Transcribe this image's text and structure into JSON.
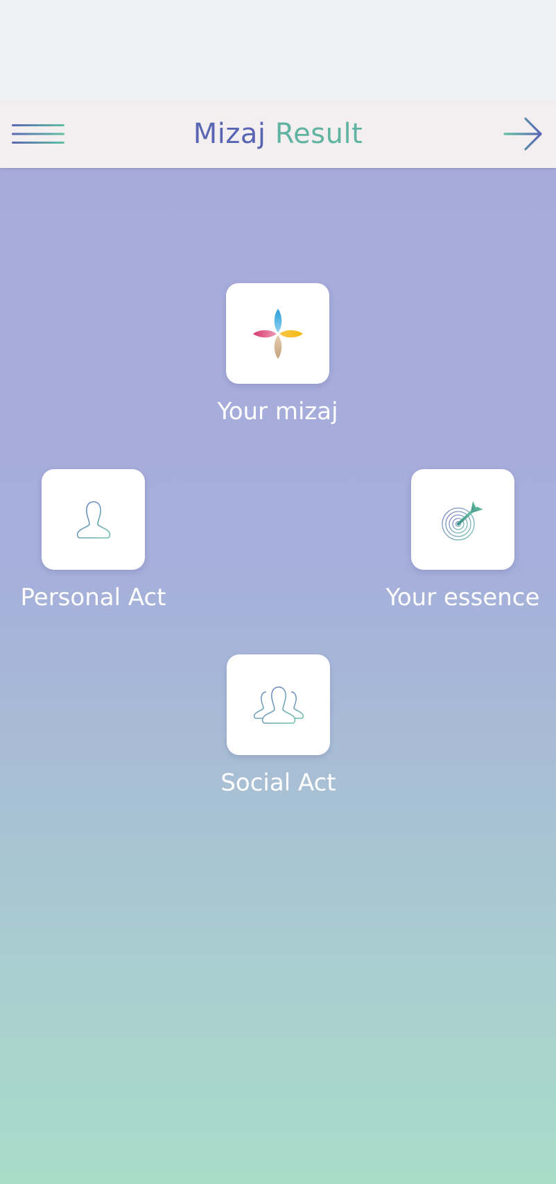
{
  "header": {
    "title_part1": "Mizaj",
    "title_part2": "Result"
  },
  "icons": {
    "menu": "hamburger-menu-icon",
    "next": "arrow-right-icon"
  },
  "tiles": [
    {
      "label": "Your mizaj",
      "icon": "four-petal-flower-icon"
    },
    {
      "label": "Personal Act",
      "icon": "person-outline-icon"
    },
    {
      "label": "Your essence",
      "icon": "target-dart-icon"
    },
    {
      "label": "Social Act",
      "icon": "group-people-icon"
    }
  ],
  "colors": {
    "brand_blue": "#5865b3",
    "brand_green": "#5fb3a0",
    "gradient_top": "#a6abdb",
    "gradient_bottom": "#a9dcc9"
  }
}
